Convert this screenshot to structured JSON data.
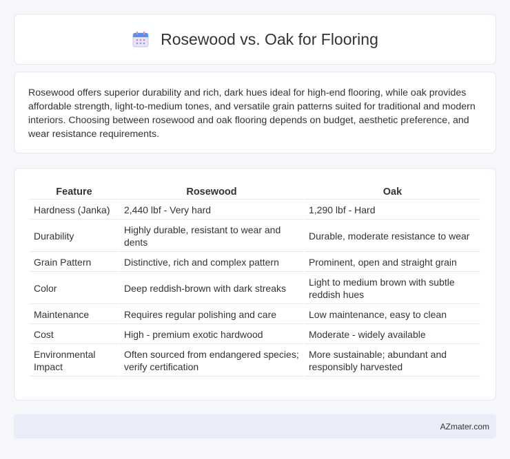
{
  "header": {
    "title": "Rosewood vs. Oak for Flooring",
    "icon": "calendar-icon"
  },
  "summary": {
    "text": "Rosewood offers superior durability and rich, dark hues ideal for high-end flooring, while oak provides affordable strength, light-to-medium tones, and versatile grain patterns suited for traditional and modern interiors. Choosing between rosewood and oak flooring depends on budget, aesthetic preference, and wear resistance requirements."
  },
  "table": {
    "headers": [
      "Feature",
      "Rosewood",
      "Oak"
    ],
    "rows": [
      [
        "Hardness (Janka)",
        "2,440 lbf - Very hard",
        "1,290 lbf - Hard"
      ],
      [
        "Durability",
        "Highly durable, resistant to wear and dents",
        "Durable, moderate resistance to wear"
      ],
      [
        "Grain Pattern",
        "Distinctive, rich and complex pattern",
        "Prominent, open and straight grain"
      ],
      [
        "Color",
        "Deep reddish-brown with dark streaks",
        "Light to medium brown with subtle reddish hues"
      ],
      [
        "Maintenance",
        "Requires regular polishing and care",
        "Low maintenance, easy to clean"
      ],
      [
        "Cost",
        "High - premium exotic hardwood",
        "Moderate - widely available"
      ],
      [
        "Environmental Impact",
        "Often sourced from endangered species; verify certification",
        "More sustainable; abundant and responsibly harvested"
      ]
    ]
  },
  "footer": {
    "brand": "AZmater.com"
  }
}
